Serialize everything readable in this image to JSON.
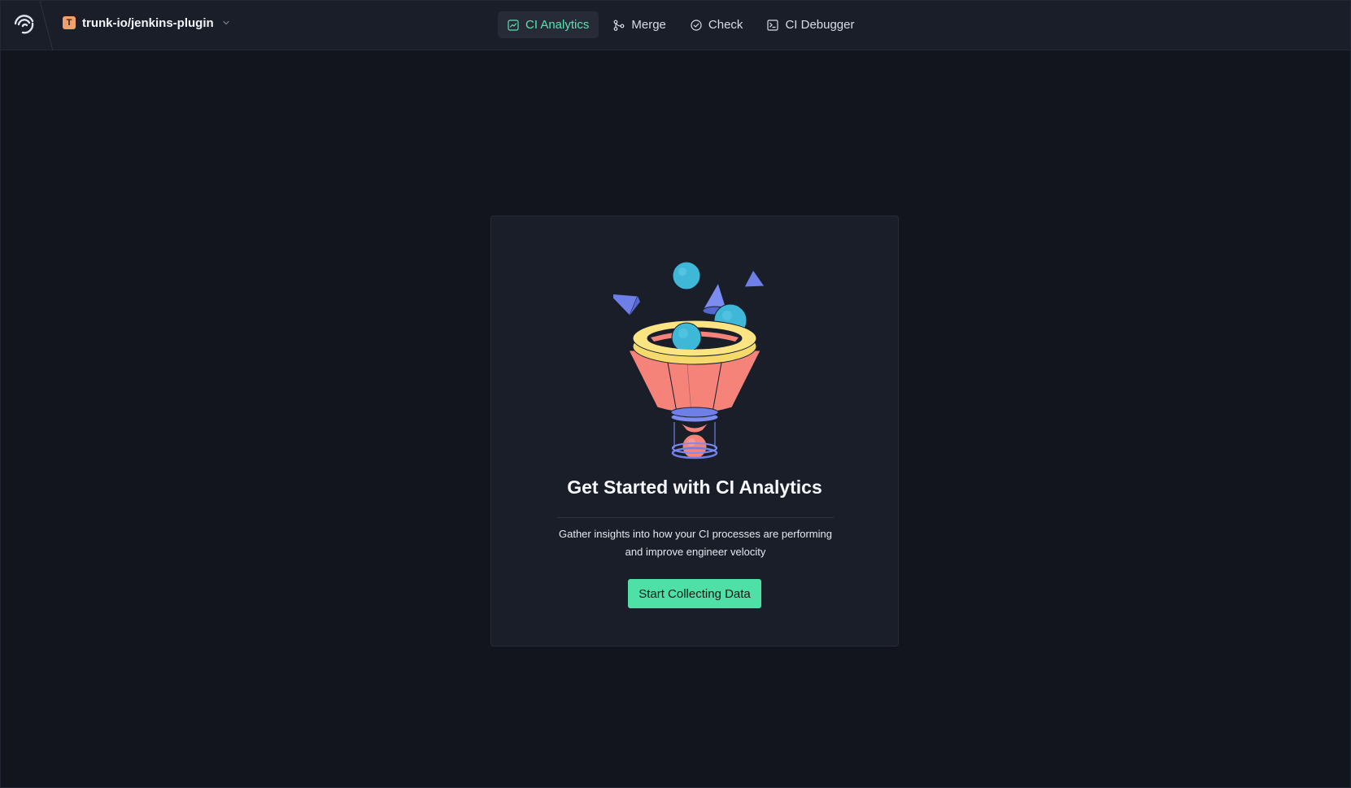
{
  "header": {
    "logo_icon": "trunk-logo-icon",
    "repo": {
      "badge": "T",
      "name": "trunk-io/jenkins-plugin",
      "badge_color": "#f0a070"
    },
    "nav": [
      {
        "label": "CI Analytics",
        "icon": "chart-icon",
        "active": true
      },
      {
        "label": "Merge",
        "icon": "merge-icon",
        "active": false
      },
      {
        "label": "Check",
        "icon": "check-circle-icon",
        "active": false
      },
      {
        "label": "CI Debugger",
        "icon": "terminal-icon",
        "active": false
      }
    ]
  },
  "empty_state": {
    "illustration": "funnel-illustration",
    "title": "Get Started with CI Analytics",
    "description_line1": "Gather insights into how your CI processes are performing",
    "description_line2": "and improve engineer velocity",
    "button_label": "Start Collecting Data"
  },
  "colors": {
    "background": "#12151d",
    "surface": "#1a1e29",
    "accent": "#57e3b0",
    "button": "#4fe0a8"
  }
}
